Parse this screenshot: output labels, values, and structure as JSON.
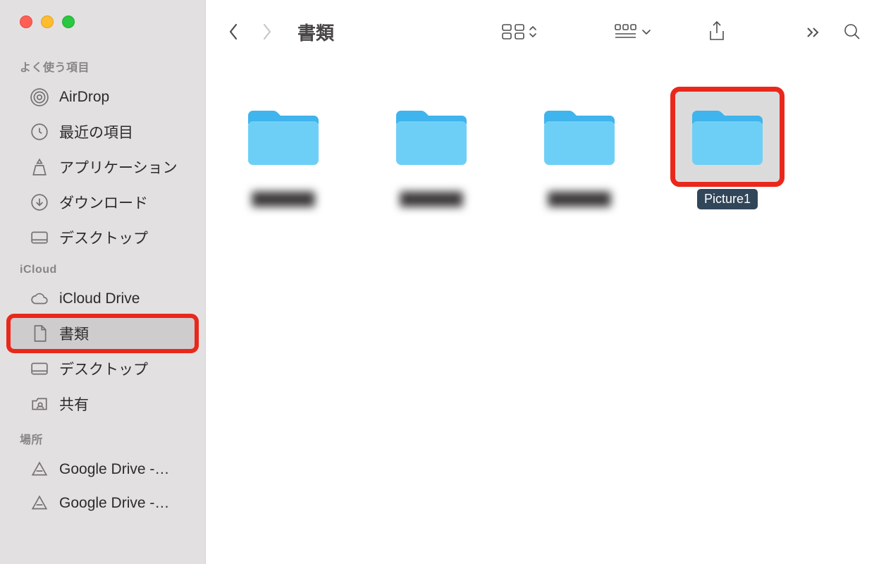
{
  "sidebar": {
    "sections": [
      {
        "label": "よく使う項目",
        "items": [
          {
            "icon": "airdrop-icon",
            "label": "AirDrop"
          },
          {
            "icon": "clock-icon",
            "label": "最近の項目"
          },
          {
            "icon": "app-icon",
            "label": "アプリケーション"
          },
          {
            "icon": "download-icon",
            "label": "ダウンロード"
          },
          {
            "icon": "desktop-icon",
            "label": "デスクトップ"
          }
        ]
      },
      {
        "label": "iCloud",
        "items": [
          {
            "icon": "cloud-icon",
            "label": "iCloud Drive"
          },
          {
            "icon": "document-icon",
            "label": "書類",
            "selected": true,
            "highlighted": true
          },
          {
            "icon": "desktop-icon",
            "label": "デスクトップ"
          },
          {
            "icon": "shared-icon",
            "label": "共有"
          }
        ]
      },
      {
        "label": "場所",
        "items": [
          {
            "icon": "drive-icon",
            "label": "Google Drive -…"
          },
          {
            "icon": "drive-icon",
            "label": "Google Drive -…"
          }
        ]
      }
    ]
  },
  "toolbar": {
    "title": "書類"
  },
  "folders": [
    {
      "label": "███████",
      "blurred": true
    },
    {
      "label": "███████",
      "blurred": true
    },
    {
      "label": "███████",
      "blurred": true
    },
    {
      "label": "Picture1",
      "selected": true,
      "highlighted": true
    }
  ]
}
